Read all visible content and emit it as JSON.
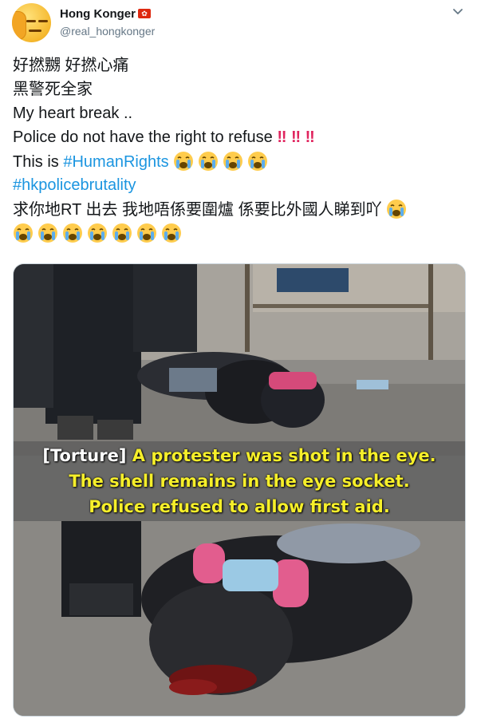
{
  "author": {
    "display_name": "Hong Konger",
    "handle": "@real_hongkonger"
  },
  "tweet": {
    "line1": "好撚嬲 好撚心痛",
    "line2": "黑警死全家",
    "line3": "My heart break ..",
    "line4_text": "Police do not have the right to refuse",
    "line4_marks": "‼ ‼ ‼",
    "line5_text": "This is",
    "line5_hashtag": "#HumanRights",
    "line6_hashtag": "#hkpolicebrutality",
    "line7": "求你地RT 出去 我地唔係要圍爐 係要比外國人睇到吖"
  },
  "media": {
    "caption_tag": "[Torture]",
    "caption_line1": "A protester was shot in the eye.",
    "caption_line2": "The shell remains in the eye socket.",
    "caption_line3": "Police refused to allow first aid."
  },
  "colors": {
    "link": "#1b95e0",
    "exclamation": "#e0245e",
    "caption_text": "#f6ef2a"
  },
  "icons": [
    "avatar-emoji",
    "hong-kong-flag-icon",
    "chevron-down-icon",
    "crying-face-emoji",
    "double-exclamation-icon"
  ]
}
